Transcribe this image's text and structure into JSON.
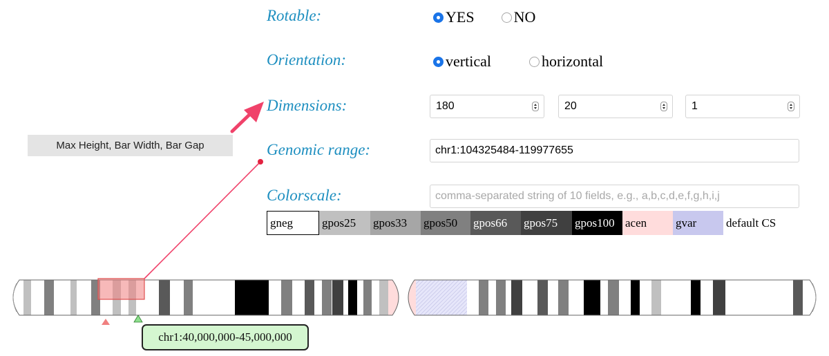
{
  "settings": {
    "rotable": {
      "label": "Rotable:",
      "options": [
        {
          "label": "YES",
          "selected": true
        },
        {
          "label": "NO",
          "selected": false
        }
      ]
    },
    "orientation": {
      "label": "Orientation:",
      "options": [
        {
          "label": "vertical",
          "selected": true
        },
        {
          "label": "horizontal",
          "selected": false
        }
      ]
    },
    "dimensions": {
      "label": "Dimensions:",
      "max_height": "180",
      "bar_width": "20",
      "bar_gap": "1"
    },
    "genomic_range": {
      "label": "Genomic range:",
      "value": "chr1:104325484-119977655"
    },
    "colorscale": {
      "label": "Colorscale:",
      "value": "",
      "placeholder": "comma-separated string of 10 fields, e.g., a,b,c,d,e,f,g,h,i,j"
    }
  },
  "tooltip": {
    "text": "Max Height, Bar Width, Bar Gap"
  },
  "legend": {
    "items": [
      {
        "label": "gneg",
        "bg": "#ffffff",
        "fg": "#000000"
      },
      {
        "label": "gpos25",
        "bg": "#c0c0c0",
        "fg": "#000000"
      },
      {
        "label": "gpos33",
        "bg": "#a6a6a6",
        "fg": "#000000"
      },
      {
        "label": "gpos50",
        "bg": "#808080",
        "fg": "#000000"
      },
      {
        "label": "gpos66",
        "bg": "#595959",
        "fg": "#ffffff"
      },
      {
        "label": "gpos75",
        "bg": "#404040",
        "fg": "#ffffff"
      },
      {
        "label": "gpos100",
        "bg": "#000000",
        "fg": "#ffffff"
      },
      {
        "label": "acen",
        "bg": "#ffdcdc",
        "fg": "#000000"
      },
      {
        "label": "gvar",
        "bg": "#c8c8ee",
        "fg": "#000000"
      },
      {
        "label": "default CS",
        "bg": "#ffffff",
        "fg": "#000000"
      }
    ]
  },
  "ideogram": {
    "locus_label": "chr1:40,000,000-45,000,000",
    "colors": {
      "highlight": "#f08080",
      "arrow": "#f0426a",
      "marker_green": "#8ee08e",
      "gvar_fill": "#e6e6f8"
    },
    "bands_left": [
      "gpos25",
      "gpos50",
      "gpos25",
      "gpos50",
      "gpos25",
      "gpos25",
      "gpos66",
      "gpos50",
      "gpos100",
      "gpos50",
      "gpos66",
      "gpos50",
      "gpos75",
      "gpos100",
      "gpos50",
      "gpos25",
      "gpos50"
    ],
    "bands_right": [
      "gvar",
      "gpos50",
      "gpos50",
      "gpos75",
      "gpos66",
      "gpos50",
      "gpos100",
      "gpos50",
      "gpos100",
      "gpos25",
      "gpos100",
      "gpos75",
      "gpos66"
    ]
  }
}
